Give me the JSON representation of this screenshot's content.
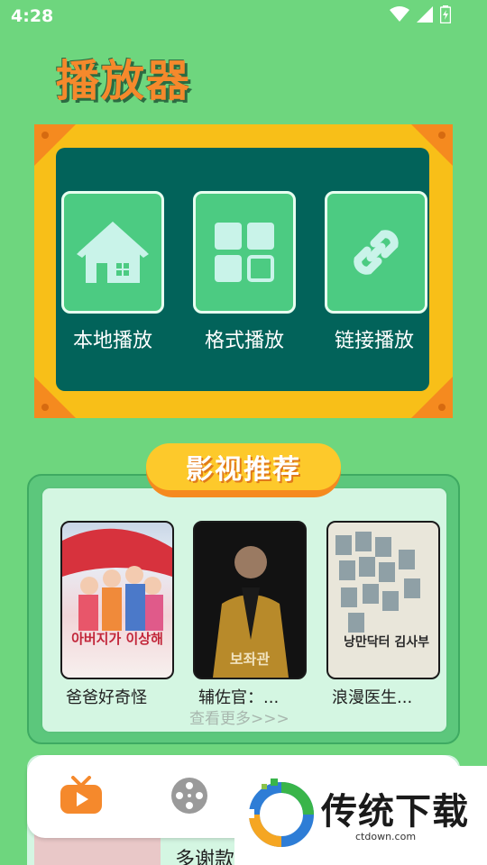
{
  "status": {
    "time": "4:28"
  },
  "app": {
    "title": "播放器"
  },
  "features": [
    {
      "label": "本地播放",
      "icon": "home-icon"
    },
    {
      "label": "格式播放",
      "icon": "grid-icon"
    },
    {
      "label": "链接播放",
      "icon": "link-icon"
    }
  ],
  "recommend": {
    "header": "影视推荐",
    "more": "查看更多>>>",
    "movies": [
      {
        "title": "爸爸好奇怪",
        "poster_text": "아버지가 이상해"
      },
      {
        "title": "辅佐官：...",
        "poster_text": "보좌관"
      },
      {
        "title": "浪漫医生...",
        "poster_text": "낭만닥터 김사부"
      }
    ]
  },
  "lower": {
    "title": "多谢款"
  },
  "tabs": [
    {
      "name": "tv-icon"
    },
    {
      "name": "film-reel-icon"
    }
  ],
  "watermark": {
    "text": "传统下载",
    "url": "ctdown.com"
  },
  "colors": {
    "background": "#6ed67e",
    "frame": "#f8bf18",
    "inner": "#02635a",
    "accent": "#f5892c"
  }
}
